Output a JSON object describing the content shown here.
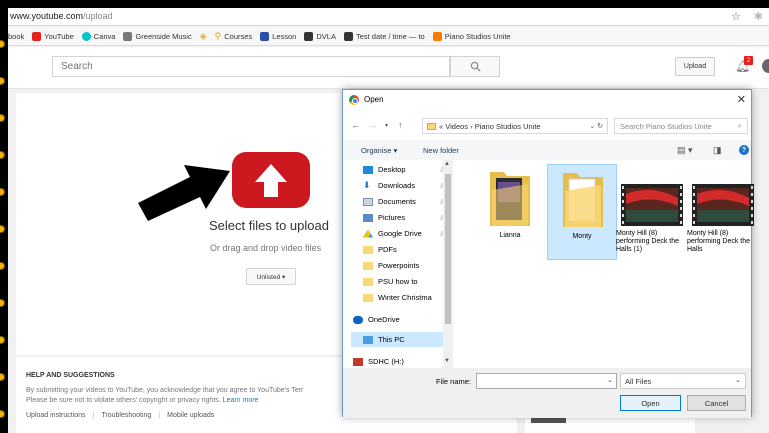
{
  "browser": {
    "url_host": "www.youtube.com",
    "url_path": "/upload",
    "bookmarks": [
      {
        "label": "book",
        "color": "#3b5998"
      },
      {
        "label": "YouTube",
        "color": "#e62117"
      },
      {
        "label": "Canva",
        "color": "#00c4cc"
      },
      {
        "label": "Greenside Music",
        "color": "#777777"
      },
      {
        "label": "",
        "color": "#e8a33d"
      },
      {
        "label": "Courses",
        "color": "#d9a400"
      },
      {
        "label": "Lesson",
        "color": "#2a4fa8"
      },
      {
        "label": "DVLA",
        "color": "#333333"
      },
      {
        "label": "Test date / time — to",
        "color": "#333333"
      },
      {
        "label": "Piano Studios Unite",
        "color": "#f57c00"
      }
    ]
  },
  "youtube": {
    "search_placeholder": "Search",
    "upload_label": "Upload",
    "notification_count": "2",
    "select_files": "Select files to upload",
    "drag_drop": "Or drag and drop video files",
    "privacy_label": "Unlisted ▾",
    "help_title": "HELP AND SUGGESTIONS",
    "help_line1": "By submitting your videos to YouTube, you acknowledge that you agree to YouTube's Terr",
    "help_line2_pre": "Please be sure not to violate others' copyright or privacy rights. ",
    "help_line2_link": "Learn more",
    "help_links": [
      "Upload instructions",
      "Troubleshooting",
      "Mobile uploads"
    ]
  },
  "dialog": {
    "title": "Open",
    "path": "« Videos › Piano Studios Unite",
    "search_placeholder": "Search Piano Studios Unite",
    "organise": "Organise ▾",
    "new_folder": "New folder",
    "tree": [
      {
        "label": "Desktop",
        "icon": "desktop",
        "pin": true
      },
      {
        "label": "Downloads",
        "icon": "download",
        "pin": true
      },
      {
        "label": "Documents",
        "icon": "document",
        "pin": true
      },
      {
        "label": "Pictures",
        "icon": "pictures",
        "pin": true
      },
      {
        "label": "Google Drive",
        "icon": "gdrive",
        "pin": true
      },
      {
        "label": "PDFs",
        "icon": "folder",
        "pin": false
      },
      {
        "label": "Powerpoints",
        "icon": "folder",
        "pin": false
      },
      {
        "label": "PSU how to",
        "icon": "folder",
        "pin": false
      },
      {
        "label": "Winter Christma",
        "icon": "folder",
        "pin": false
      },
      {
        "label": "OneDrive",
        "icon": "onedrive",
        "pin": false
      },
      {
        "label": "This PC",
        "icon": "pc",
        "pin": false
      },
      {
        "label": "SDHC (H:)",
        "icon": "sd",
        "pin": false
      }
    ],
    "files": [
      {
        "name": "Lianna",
        "type": "folder"
      },
      {
        "name": "Monty",
        "type": "folder"
      },
      {
        "name": "Monty Hill (8) performing Deck the Halls (1)",
        "type": "video"
      },
      {
        "name": "Monty Hill (8) performing Deck the Halls",
        "type": "video"
      }
    ],
    "file_name_label": "File name:",
    "file_name_value": "",
    "file_type": "All Files",
    "open_label": "Open",
    "cancel_label": "Cancel"
  }
}
